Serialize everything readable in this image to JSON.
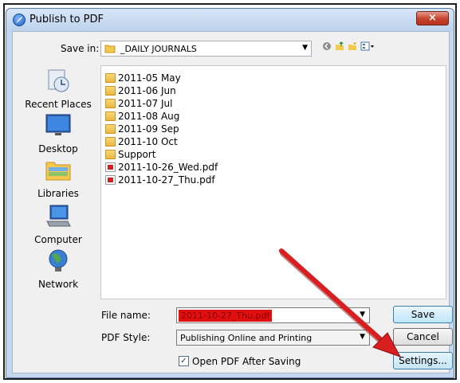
{
  "window": {
    "title": "Publish to PDF",
    "close_label": "×"
  },
  "save_in": {
    "label": "Save in:",
    "folder": "_DAILY JOURNALS"
  },
  "places": [
    {
      "label": "Recent Places",
      "icon": "recent-places-icon"
    },
    {
      "label": "Desktop",
      "icon": "desktop-icon"
    },
    {
      "label": "Libraries",
      "icon": "libraries-icon"
    },
    {
      "label": "Computer",
      "icon": "computer-icon"
    },
    {
      "label": "Network",
      "icon": "network-icon"
    }
  ],
  "files": [
    {
      "name": "2011-05 May",
      "type": "folder"
    },
    {
      "name": "2011-06 Jun",
      "type": "folder"
    },
    {
      "name": "2011-07 Jul",
      "type": "folder"
    },
    {
      "name": "2011-08 Aug",
      "type": "folder"
    },
    {
      "name": "2011-09 Sep",
      "type": "folder"
    },
    {
      "name": "2011-10 Oct",
      "type": "folder"
    },
    {
      "name": "Support",
      "type": "folder"
    },
    {
      "name": "2011-10-26_Wed.pdf",
      "type": "pdf"
    },
    {
      "name": "2011-10-27_Thu.pdf",
      "type": "pdf"
    }
  ],
  "form": {
    "file_name_label": "File name:",
    "file_name_value": "2011-10-27_Thu.pdf",
    "pdf_style_label": "PDF Style:",
    "pdf_style_value": "Publishing Online and Printing",
    "open_after_label": "Open PDF After Saving",
    "open_after_checked": true
  },
  "buttons": {
    "save": "Save",
    "cancel": "Cancel",
    "settings": "Settings..."
  },
  "colors": {
    "annotation_arrow": "#d81e1e",
    "filename_highlight": "#e01010"
  }
}
